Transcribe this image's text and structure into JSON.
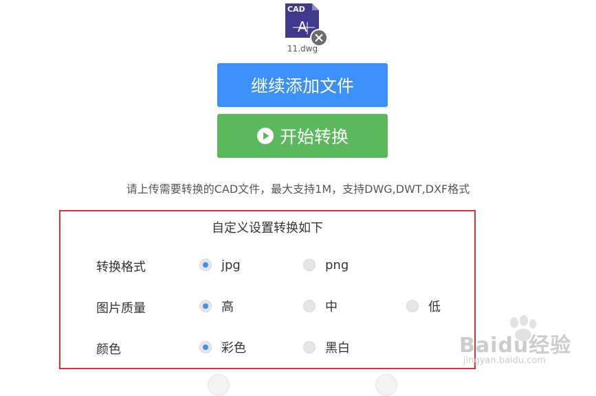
{
  "file": {
    "icon_label": "CAD",
    "icon_glyph": "A",
    "name": "11.dwg",
    "icon_color": "#3f3a8c"
  },
  "buttons": {
    "add_label": "继续添加文件",
    "start_label": "开始转换",
    "add_color": "#3d90f5",
    "start_color": "#5cb85c"
  },
  "hint": "请上传需要转换的CAD文件，最大支持1M，支持DWG,DWT,DXF格式",
  "settings": {
    "title": "自定义设置转换如下",
    "rows": [
      {
        "label": "转换格式",
        "options": [
          "jpg",
          "png"
        ],
        "selected": 0
      },
      {
        "label": "图片质量",
        "options": [
          "高",
          "中",
          "低"
        ],
        "selected": 0
      },
      {
        "label": "颜色",
        "options": [
          "彩色",
          "黑白"
        ],
        "selected": 0
      }
    ]
  },
  "watermark": {
    "text": "Baidu经验",
    "url": "jingyan.baidu.com"
  }
}
